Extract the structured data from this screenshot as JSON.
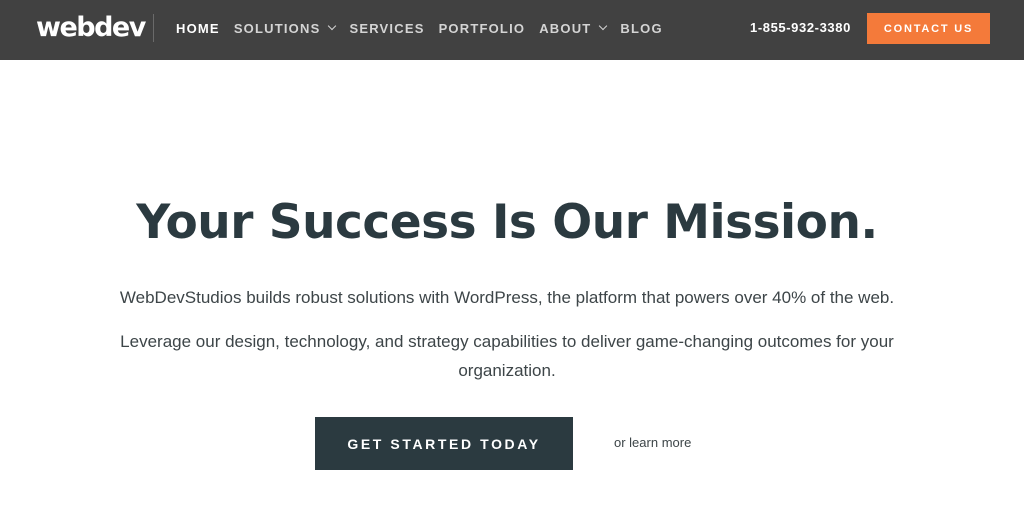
{
  "header": {
    "logo": "webdev",
    "nav": [
      {
        "label": "HOME",
        "active": true,
        "dropdown": false
      },
      {
        "label": "SOLUTIONS",
        "active": false,
        "dropdown": true
      },
      {
        "label": "SERVICES",
        "active": false,
        "dropdown": false
      },
      {
        "label": "PORTFOLIO",
        "active": false,
        "dropdown": false
      },
      {
        "label": "ABOUT",
        "active": false,
        "dropdown": true
      },
      {
        "label": "BLOG",
        "active": false,
        "dropdown": false
      }
    ],
    "phone": "1-855-932-3380",
    "contact_label": "CONTACT US"
  },
  "hero": {
    "title": "Your Success Is Our Mission.",
    "subtitle": "WebDevStudios builds robust solutions with WordPress, the platform that powers over 40% of the web.",
    "subtitle2": "Leverage our design, technology, and strategy capabilities to deliver game-changing outcomes for your organization.",
    "cta_label": "GET STARTED TODAY",
    "learn_more": "or learn more"
  },
  "colors": {
    "header_bg": "#414141",
    "accent": "#f47a3a",
    "dark": "#2b3a40",
    "background": "#ffffff"
  }
}
